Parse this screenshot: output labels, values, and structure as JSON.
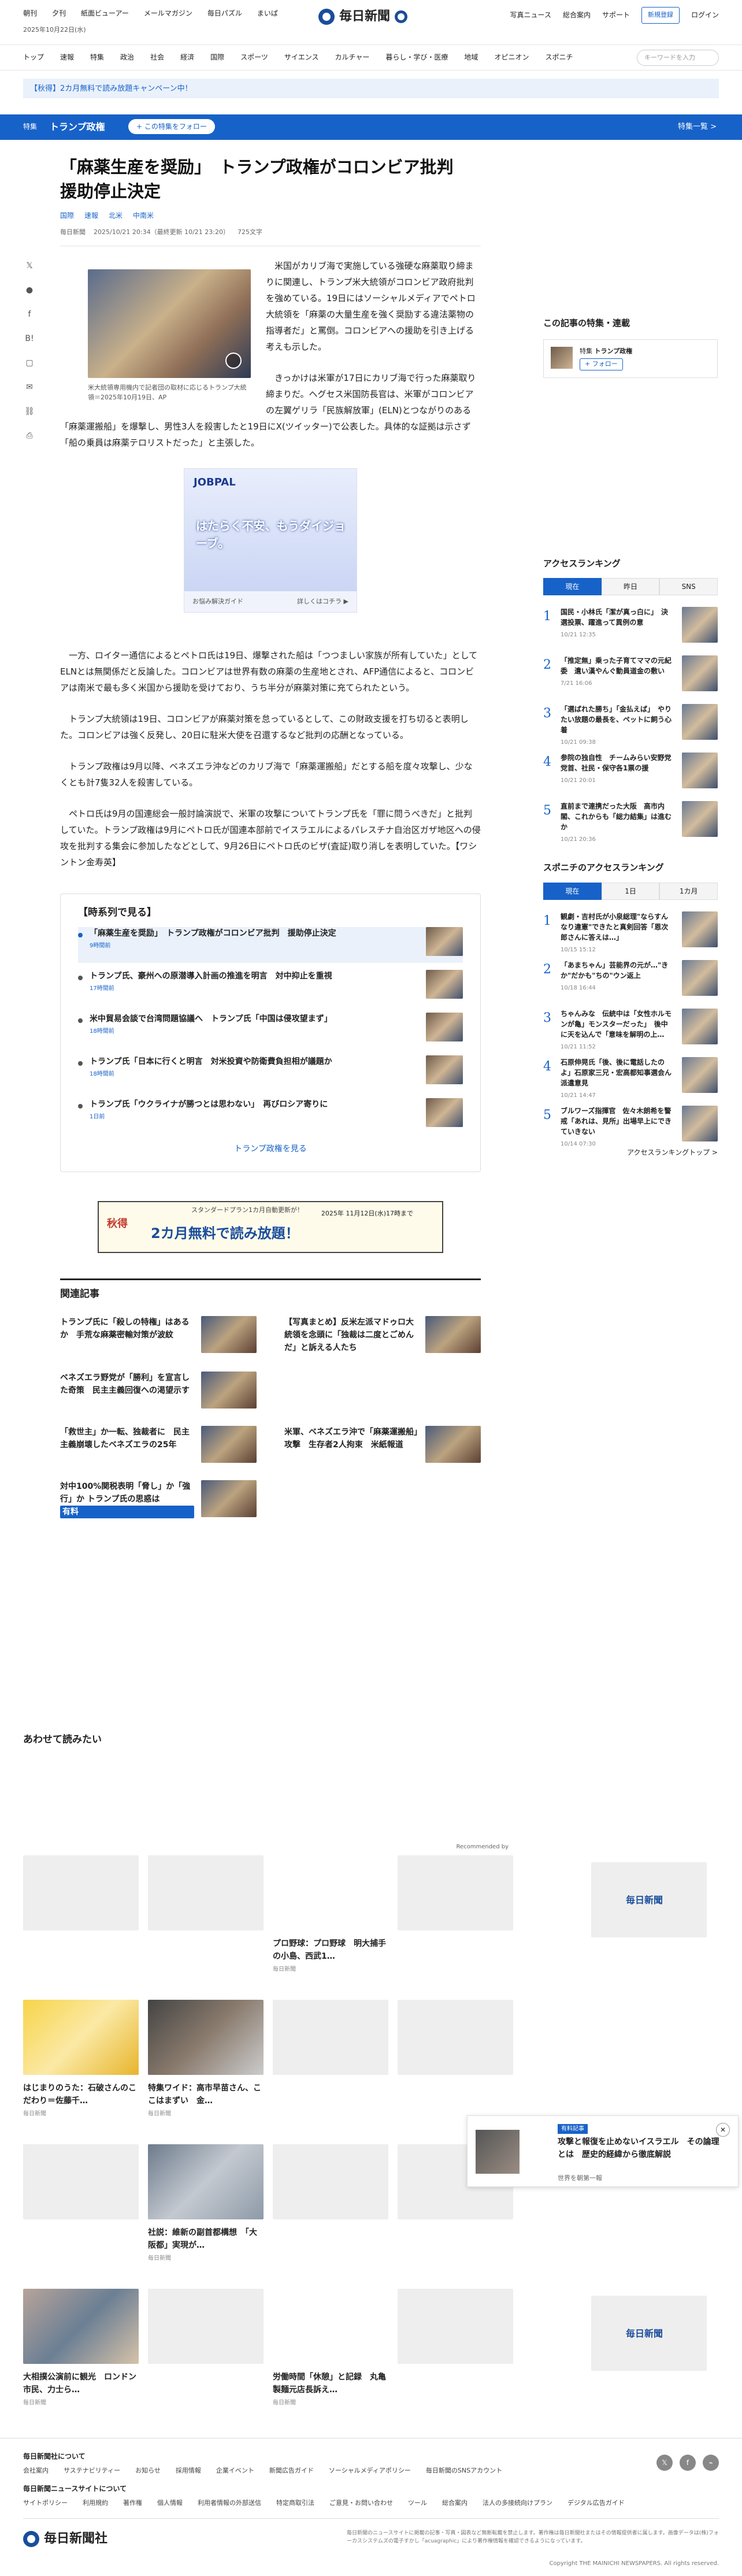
{
  "header": {
    "nav": [
      "朝刊",
      "夕刊",
      "紙面ビューアー",
      "メールマガジン",
      "毎日パズル",
      "まいぱ"
    ],
    "date": "2025年10月22日(水)",
    "logo": "毎日新聞",
    "right": [
      "写真ニュース",
      "総合案内",
      "サポート"
    ],
    "register": "新規登録",
    "login": "ログイン"
  },
  "mainnav": {
    "items": [
      "トップ",
      "速報",
      "特集",
      "政治",
      "社会",
      "経済",
      "国際",
      "スポーツ",
      "サイエンス",
      "カルチャー",
      "暮らし・学び・医療",
      "地域",
      "オピニオン",
      "スポニチ"
    ],
    "search_placeholder": "キーワードを入力"
  },
  "campaign": "【秋得】2カ月無料で読み放題キャンペーン中！",
  "featurebar": {
    "tag": "特集",
    "title": "トランプ政権",
    "follow": "+ この特集をフォロー",
    "all": "特集一覧 >"
  },
  "article": {
    "headline": "「麻薬生産を奨励」　トランプ政権がコロンビア批判　援助停止決定",
    "tags": [
      "国際",
      "速報",
      "北米",
      "中南米"
    ],
    "source": "毎日新聞",
    "date": "2025/10/21 20:34（最終更新 10/21 23:20）",
    "chars": "725文字",
    "photo_caption": "米大統領専用機内で記者団の取材に応じるトランプ大統領＝2025年10月19日、AP",
    "p1": "米国がカリブ海で実施している強硬な麻薬取り締まりに関連し、トランプ米大統領がコロンビア政府批判を強めている。19日にはソーシャルメディアでペトロ大統領を「麻薬の大量生産を強く奨励する違法薬物の指導者だ」と罵倒。コロンビアへの援助を引き上げる考えも示した。",
    "p2": "きっかけは米軍が17日にカリブ海で行った麻薬取り締まりだ。ヘグセス米国防長官は、米軍がコロンビアの左翼ゲリラ「民族解放軍」(ELN)とつながりのある「麻薬運搬船」を爆撃し、男性3人を殺害したと19日にX(ツイッター)で公表した。具体的な証拠は示さず「船の乗員は麻薬テロリストだった」と主張した。",
    "p3": "一方、ロイター通信によるとペトロ氏は19日、爆撃された船は「つつましい家族が所有していた」としてELNとは無関係だと反論した。コロンビアは世界有数の麻薬の生産地とされ、AFP通信によると、コロンビアは南米で最も多く米国から援助を受けており、うち半分が麻薬対策に充てられたという。",
    "p4": "トランプ大統領は19日、コロンビアが麻薬対策を怠っているとして、この財政支援を打ち切ると表明した。コロンビアは強く反発し、20日に駐米大使を召還するなど批判の応酬となっている。",
    "p5": "トランプ政権は9月以降、ベネズエラ沖などのカリブ海で「麻薬運搬船」だとする船を度々攻撃し、少なくとも計7隻32人を殺害している。",
    "p6": "ペトロ氏は9月の国連総会一般討論演説で、米軍の攻撃についてトランプ氏を「罪に問うべきだ」と批判していた。トランプ政権は9月にペトロ氏が国連本部前でイスラエルによるパレスチナ自治区ガザ地区への侵攻を批判する集会に参加したなどとして、9月26日にペトロ氏のビザ(査証)取り消しを表明していた。【ワシントン金寿英】"
  },
  "ad": {
    "logo": "JOBPAL",
    "text": "はたらく不安、もうダイジョーブ。",
    "foot_left": "お悩み解決ガイド",
    "foot_right": "詳しくはコチラ ▶"
  },
  "timeline": {
    "title": "【時系列で見る】",
    "items": [
      {
        "title": "「麻薬生産を奨励」　トランプ政権がコロンビア批判　援助停止決定",
        "date": "9時間前"
      },
      {
        "title": "トランプ氏、豪州への原潜導入計画の推進を明言　対中抑止を重視",
        "date": "17時間前"
      },
      {
        "title": "米中貿易会談で台湾問題協議へ　トランプ氏「中国は侵攻望まず」",
        "date": "18時間前"
      },
      {
        "title": "トランプ氏「日本に行くと明言　対米投資や防衛費負担相が議題か",
        "date": "18時間前"
      },
      {
        "title": "トランプ氏「ウクライナが勝つとは思わない」　再びロシア寄りに",
        "date": "1日前"
      }
    ],
    "more": "トランプ政権を見る"
  },
  "promo": {
    "line1": "スタンダードプラン1カ月自動更新が！",
    "line2": "2カ月無料で読み放題！",
    "line3": "2025年 11月12日(水)17時まで",
    "badge": "秋得"
  },
  "related": {
    "title": "関連記事",
    "items": [
      {
        "title": "トランプ氏に「殺しの特権」はあるか　手荒な麻薬密輸対策が波紋",
        "badge": ""
      },
      {
        "title": "【写真まとめ】反米左派マドゥロ大統領を念頭に「独裁は二度とごめんだ」と訴える人たち",
        "badge": ""
      },
      {
        "title": "ベネズエラ野党が「勝利」を宣言した奇策　民主主義回復への渇望示す",
        "badge": ""
      },
      {
        "title": "",
        "badge": ""
      },
      {
        "title": "「救世主」か一転、独裁者に　民主主義崩壊したベネズエラの25年",
        "badge": ""
      },
      {
        "title": "米軍、ベネズエラ沖で「麻薬運搬船」攻撃　生存者2人拘束　米紙報道",
        "badge": ""
      },
      {
        "title": "対中100%関税表明「脅し」か「強行」か トランプ氏の思惑は",
        "badge": "有料"
      }
    ]
  },
  "sidebar": {
    "feature_title": "この記事の特集・連載",
    "feature_tag": "特集",
    "feature_name": "トランプ政権",
    "feature_follow": "+ フォロー",
    "rank_title": "アクセスランキング",
    "rank_tabs": [
      "現在",
      "昨日",
      "SNS"
    ],
    "ranks": [
      {
        "t": "国民・小林氏「潔が真っ白に」　決選投票、躍進って異例の意",
        "d": "10/21 12:35"
      },
      {
        "t": "「推定無」乗った子育てママの元紀委　遺い漢やんぐ動員道金の敷い",
        "d": "7/21 16:06"
      },
      {
        "t": "「選ばれた勝ち」「金払えば」　やりたい放題の最長を、ペットに飼う心着",
        "d": "10/21 09:38"
      },
      {
        "t": "参院の独自性　チームみらい安野党党首、社民・保守各1票の援",
        "d": "10/21 20:01"
      },
      {
        "t": "直前まで連携だった大阪　高市内閣、これからも「総力結集」は進むか",
        "d": "10/21 20:36"
      }
    ],
    "sponichi_title": "スポニチのアクセスランキング",
    "sponichi_tabs": [
      "現在",
      "1日",
      "1カ月"
    ],
    "sponichi": [
      {
        "t": "観劇・吉村氏が小泉総理\"ならすんなり違憲\"できたと真剣回答「恩次郎さんに答えは…」",
        "d": "10/15 15:12"
      },
      {
        "t": "「あまちゃん」芸能界の元が…\"きか\"だかも\"ちの\"ウン返上",
        "d": "10/18 16:44"
      },
      {
        "t": "ちゃんみな　伝統中は「女性ホルモンが亀」モンスターだった」　後中に天を込んで「意味を解明の上…",
        "d": "10/21 11:52"
      },
      {
        "t": "石原伸晃氏「後、後に電話したのよ」石原家三兄・宏高都知事選会ん派遣意見",
        "d": "10/21 14:47"
      },
      {
        "t": "ブルワーズ指揮官　佐々木朗希を警戒「あれは、見所」出場早上にできていきない",
        "d": "10/14 07:30"
      }
    ],
    "rank_more": "アクセスランキングトップ >"
  },
  "readalso": {
    "title": "あわせて読みたい",
    "rec": "Recommended by",
    "cards": [
      {
        "title": "",
        "src": "",
        "img": ""
      },
      {
        "title": "",
        "src": "",
        "img": ""
      },
      {
        "title": "プロ野球：プロ野球　明大捕手の小島、西武1…",
        "src": "毎日新聞",
        "img": "logo"
      },
      {
        "title": "",
        "src": "",
        "img": ""
      },
      {
        "title": "はじまりのうた：石破さんのこだわり＝佐藤千…",
        "src": "毎日新聞",
        "img": "photo1"
      },
      {
        "title": "特集ワイド：高市早苗さん、ここはまずい　金…",
        "src": "毎日新聞",
        "img": "photo2"
      },
      {
        "title": "",
        "src": "",
        "img": ""
      },
      {
        "title": "",
        "src": "",
        "img": ""
      },
      {
        "title": "",
        "src": "",
        "img": ""
      },
      {
        "title": "社説：維新の副首都構想　「大阪都」実現が…",
        "src": "毎日新聞",
        "img": "photo3"
      },
      {
        "title": "",
        "src": "",
        "img": ""
      },
      {
        "title": "",
        "src": "",
        "img": ""
      },
      {
        "title": "大相撲公演前に観光　ロンドン市民、力士ら…",
        "src": "毎日新聞",
        "img": "photo4"
      },
      {
        "title": "",
        "src": "",
        "img": ""
      },
      {
        "title": "労働時間「休憩」と記録　丸亀製麺元店長訴え…",
        "src": "毎日新聞",
        "img": "logo"
      },
      {
        "title": "",
        "src": "",
        "img": ""
      }
    ]
  },
  "floatcard": {
    "badge": "有料記事",
    "title": "攻撃と報復を止めないイスラエル　その論理とは　歴史的経緯から徹底解説",
    "source": "世界を朝第一報"
  },
  "footer": {
    "about": "毎日新聞社について",
    "about_links": [
      "会社案内",
      "サステナビリティー",
      "お知らせ",
      "採用情報",
      "企業イベント",
      "新聞広告ガイド",
      "ソーシャルメディアポリシー",
      "毎日新聞のSNSアカウント"
    ],
    "site": "毎日新聞ニュースサイトについて",
    "site_links": [
      "サイトポリシー",
      "利用規約",
      "著作権",
      "個人情報",
      "利用者情報の外部送信",
      "特定商取引法",
      "ご意見・お問い合わせ",
      "ツール",
      "総合案内",
      "法人の多接続向けプラン",
      "デジタル広告ガイド"
    ],
    "logo": "毎日新聞社",
    "note": "毎日新聞のニュースサイトに掲載の記事・写真・図表など無断転載を禁止します。著作権は毎日新聞社またはその情報提供者に属します。画像データは(株)フォーカスシステムズの電子すかし「acuagraphic」により著作権情報を確認できるようになっています。",
    "copy": "Copyright THE MAINICHI NEWSPAPERS. All rights reserved."
  }
}
